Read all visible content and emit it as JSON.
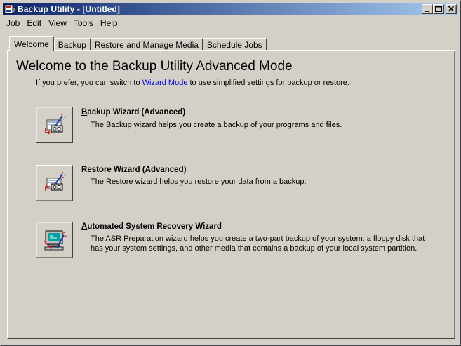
{
  "window": {
    "title": "Backup Utility - [Untitled]"
  },
  "menu": [
    {
      "key": "J",
      "rest": "ob"
    },
    {
      "key": "E",
      "rest": "dit"
    },
    {
      "key": "V",
      "rest": "iew"
    },
    {
      "key": "T",
      "rest": "ools"
    },
    {
      "key": "H",
      "rest": "elp"
    }
  ],
  "tabs": [
    "Welcome",
    "Backup",
    "Restore and Manage Media",
    "Schedule Jobs"
  ],
  "welcome": {
    "heading": "Welcome to the Backup Utility Advanced Mode",
    "intro_before": "If you prefer, you can switch to ",
    "intro_link": "Wizard Mode",
    "intro_after": " to use simplified settings for backup or restore."
  },
  "wizards": [
    {
      "key": "B",
      "rest": "ackup Wizard (Advanced)",
      "desc": "The Backup wizard helps you create a backup of your programs and files.",
      "icon": "backup-wizard-icon"
    },
    {
      "key": "R",
      "rest": "estore Wizard (Advanced)",
      "desc": "The Restore wizard helps you restore your data from a backup.",
      "icon": "restore-wizard-icon"
    },
    {
      "key": "A",
      "rest": "utomated System Recovery Wizard",
      "desc": "The ASR Preparation wizard helps you create a two-part backup of your system: a floppy disk that has your system settings, and other media that contains a backup of your local system partition.",
      "icon": "asr-wizard-icon"
    }
  ],
  "colors": {
    "titlebar_start": "#0a246a",
    "titlebar_end": "#a6caf0",
    "face": "#d4d0c8",
    "link": "#0000ee"
  }
}
